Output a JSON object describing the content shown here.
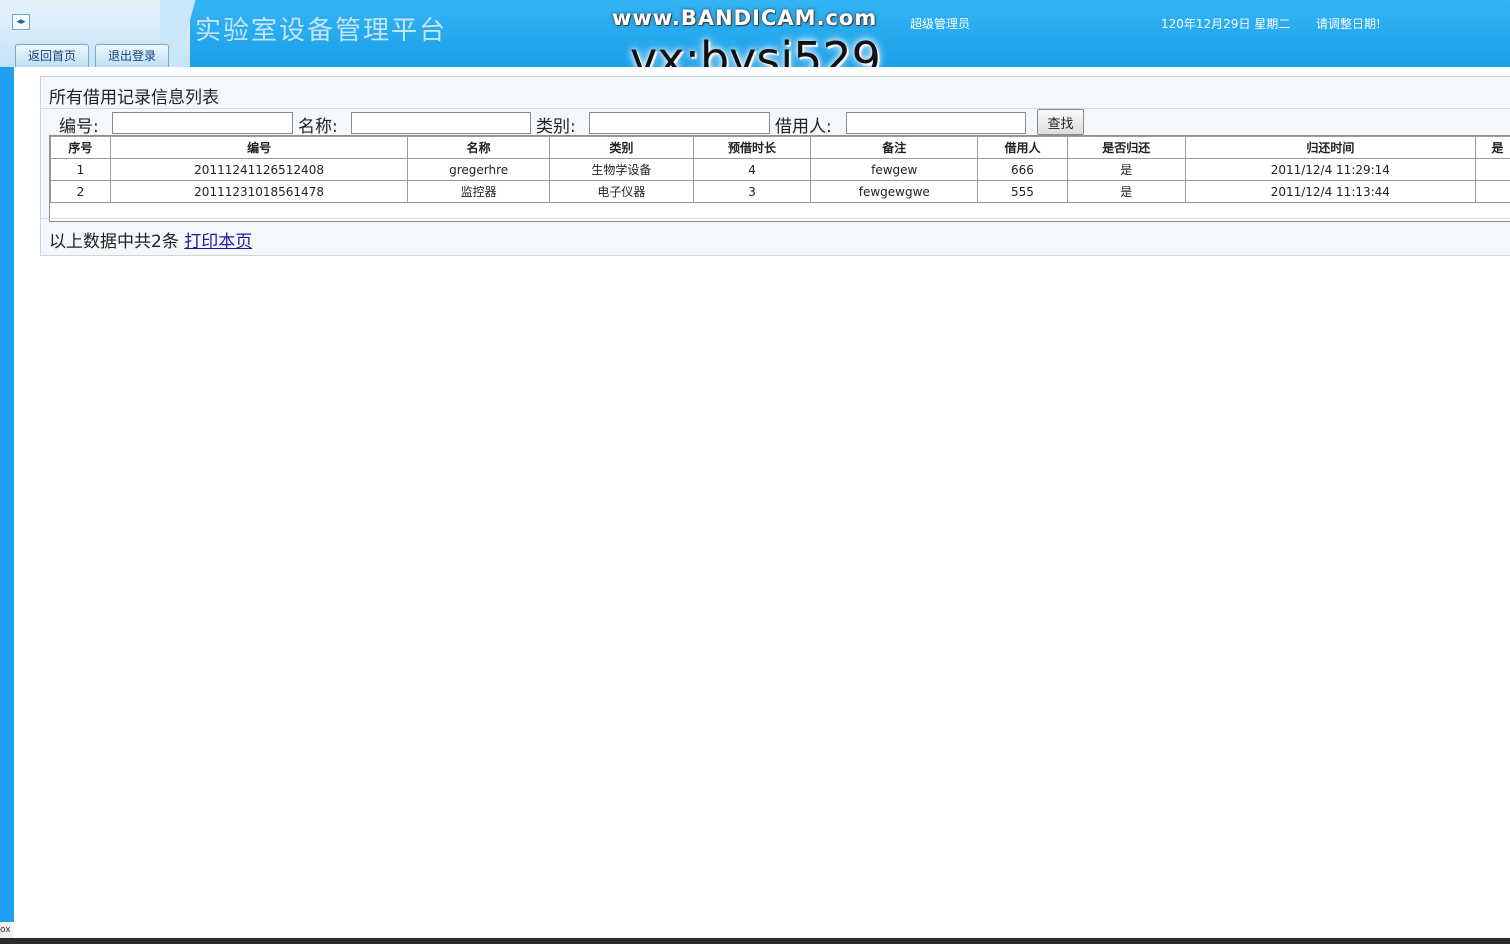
{
  "header": {
    "title": "实验室设备管理平台",
    "watermark": "www.BANDICAM.com",
    "watermark2": "vx:bysj529",
    "user_role": "超级管理员",
    "date": "120年12月29日 星期二",
    "date_tip": "请调整日期!",
    "toggle_icon": "◂▸"
  },
  "nav": {
    "home": "返回首页",
    "logout": "退出登录"
  },
  "status_tag": "ox",
  "panel": {
    "title": "所有借用记录信息列表",
    "filters": {
      "code_label": "编号:",
      "code_value": "",
      "name_label": "名称:",
      "name_value": "",
      "category_label": "类别:",
      "category_value": "",
      "borrower_label": "借用人:",
      "borrower_value": ""
    },
    "search_button": "查找",
    "table": {
      "headers": [
        "序号",
        "编号",
        "名称",
        "类别",
        "预借时长",
        "备注",
        "借用人",
        "是否归还",
        "归还时间",
        "是"
      ],
      "rows": [
        [
          "1",
          "20111241126512408",
          "gregerhre",
          "生物学设备",
          "4",
          "fewgew",
          "666",
          "是",
          "2011/12/4 11:29:14",
          ""
        ],
        [
          "2",
          "20111231018561478",
          "监控器",
          "电子仪器",
          "3",
          "fewgewgwe",
          "555",
          "是",
          "2011/12/4 11:13:44",
          ""
        ]
      ]
    },
    "footer": {
      "summary": "以上数据中共2条",
      "print_link": "打印本页"
    }
  }
}
